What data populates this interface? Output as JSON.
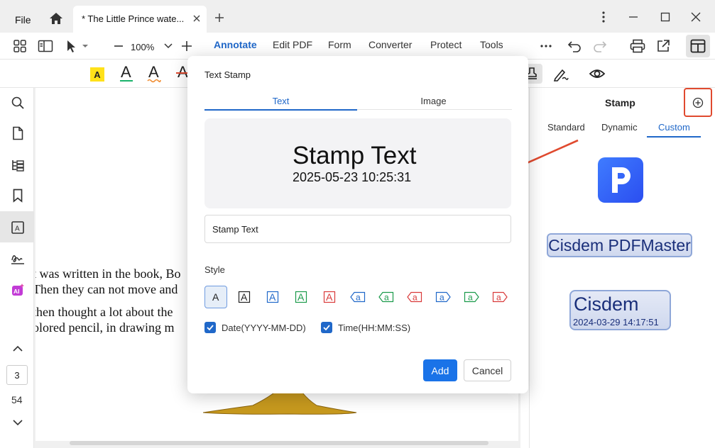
{
  "titlebar": {
    "file_label": "File",
    "tab_title": "* The Little Prince wate...",
    "icons": [
      "home-icon",
      "close-icon",
      "plus-icon",
      "kebab-icon",
      "minimize-icon",
      "maximize-icon",
      "close-icon"
    ]
  },
  "toolbar": {
    "zoom": "100%",
    "menu": [
      "Annotate",
      "Edit PDF",
      "Form",
      "Converter",
      "Protect",
      "Tools"
    ],
    "active_menu": "Annotate",
    "accent_color": "#2068c9"
  },
  "document": {
    "lines": [
      "t was written in the book, Bo",
      "Then they can not move and",
      " then thought a lot about the",
      "olored pencil, in drawing m"
    ]
  },
  "sidebar": {
    "current_page": "3",
    "total_pages": "54"
  },
  "right_panel": {
    "title": "Stamp",
    "tabs": [
      "Standard",
      "Dynamic",
      "Custom"
    ],
    "active_tab": "Custom",
    "stamps": {
      "stamp1": "Cisdem PDFMaster",
      "stamp2_name": "Cisdem",
      "stamp2_date": "2024-03-29 14:17:51"
    }
  },
  "dialog": {
    "title": "Text Stamp",
    "tabs": [
      "Text",
      "Image"
    ],
    "preview_text": "Stamp Text",
    "preview_date": "2025-05-23 10:25:31",
    "input_value": "Stamp Text",
    "style_label": "Style",
    "style_glyph": "A",
    "style_colors": [
      "#222222",
      "#222222",
      "#2068c9",
      "#1a9a4a",
      "#d93a3a",
      "#2068c9",
      "#1a9a4a",
      "#d93a3a",
      "#2068c9",
      "#1a9a4a",
      "#d93a3a"
    ],
    "date_label": "Date(YYYY-MM-DD)",
    "time_label": "Time(HH:MM:SS)",
    "add_label": "Add",
    "cancel_label": "Cancel"
  }
}
